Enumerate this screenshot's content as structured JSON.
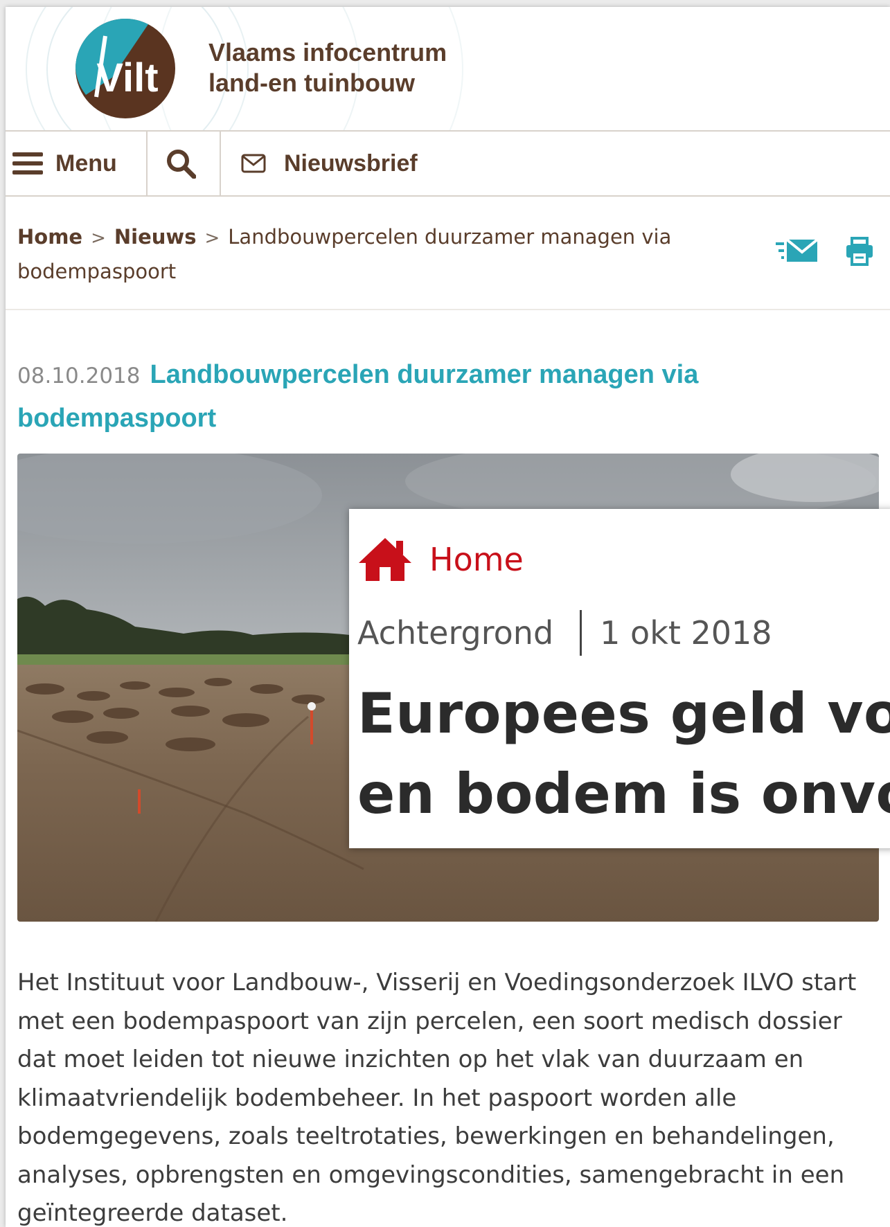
{
  "site": {
    "logo_text": "Vilt",
    "title_line1": "Vlaams infocentrum",
    "title_line2": "land-en tuinbouw"
  },
  "toolbar": {
    "menu_label": "Menu",
    "newsletter_label": "Nieuwsbrief"
  },
  "breadcrumb": {
    "home": "Home",
    "news": "Nieuws",
    "current": "Landbouwpercelen duurzamer managen via bodempaspoort"
  },
  "article": {
    "date": "08.10.2018",
    "title": "Landbouwpercelen duurzamer managen via bodempaspoort",
    "body": "Het Instituut voor Landbouw-, Visserij en Voedingsonderzoek ILVO start met een bodempaspoort van zijn percelen, een soort medisch dossier dat moet leiden tot nieuwe inzichten op het vlak van duurzaam en klimaatvriendelijk bodembeheer. In het paspoort worden alle bodemgegevens, zoals teeltrotaties, bewerkingen en behandelingen, analyses, opbrengsten en omgevingscondities, samengebracht in een geïntegreerde dataset."
  },
  "popup": {
    "home": "Home",
    "category": "Achtergrond",
    "date": "1 okt 2018",
    "headline_line1": "Europees geld voo",
    "headline_line2": "en bodem is onvol"
  },
  "colors": {
    "brown": "#5a3d2b",
    "teal": "#2aa5b6",
    "popup_red": "#c8101a"
  },
  "icons": [
    "hamburger-icon",
    "search-icon",
    "mail-icon",
    "chevron-right-icon",
    "share-mail-icon",
    "print-icon",
    "home-icon"
  ]
}
